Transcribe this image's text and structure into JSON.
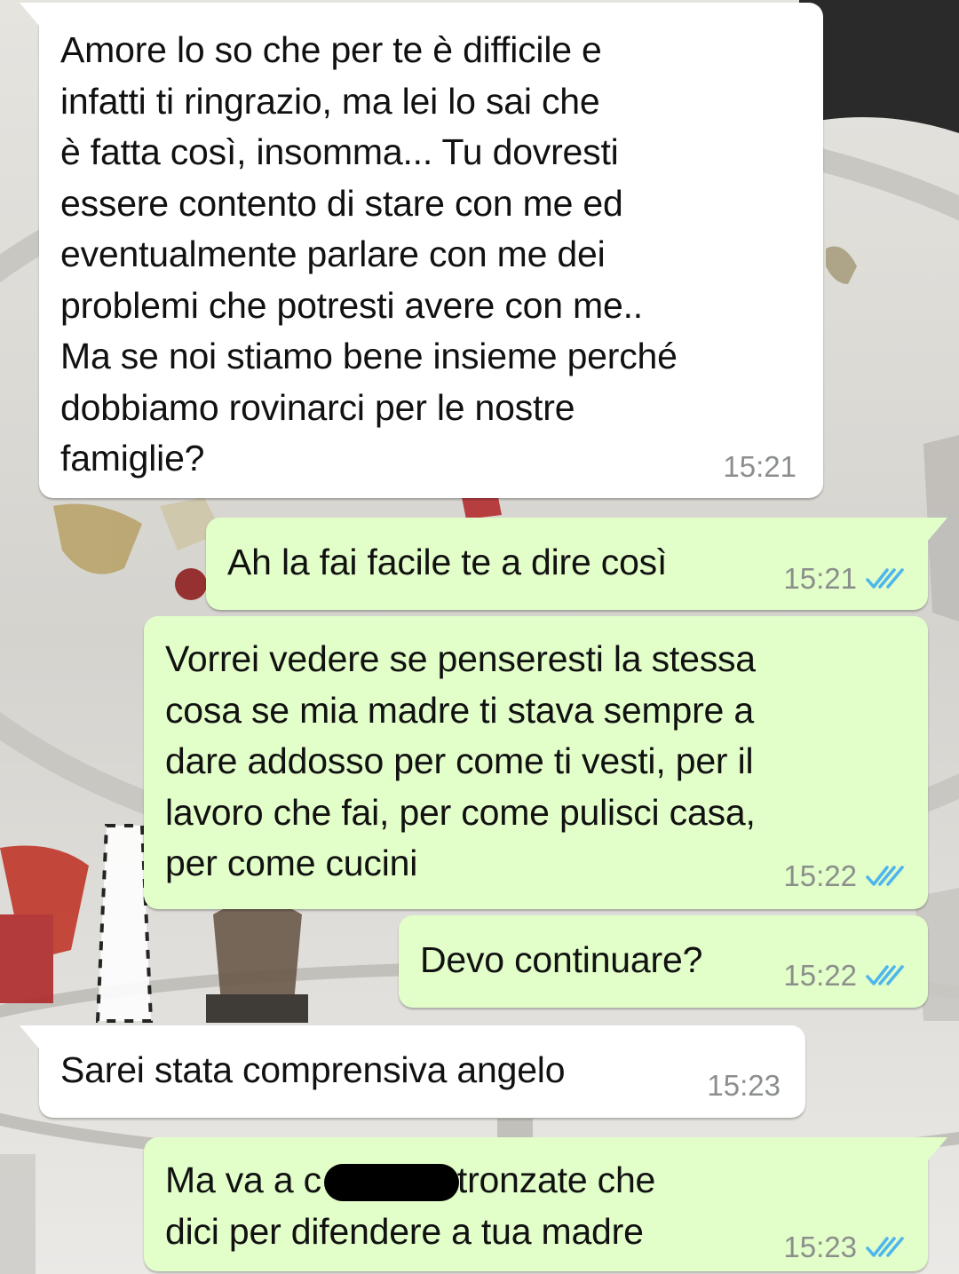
{
  "theme": {
    "incoming_bubble": "#ffffff",
    "outgoing_bubble": "#e2fec9",
    "read_ticks": "#4fb6ec",
    "timestamp": "#8b8f8c"
  },
  "messages": [
    {
      "direction": "incoming",
      "lines": [
        "Amore lo so che per te è difficile e",
        "infatti ti ringrazio, ma lei lo sai che",
        "è fatta così, insomma... Tu dovresti",
        "essere contento di stare con me ed",
        "eventualmente parlare con me dei",
        "problemi che potresti avere con me..",
        "Ma se noi stiamo bene insieme perché",
        "dobbiamo rovinarci per le nostre",
        "famiglie?"
      ],
      "time": "15:21"
    },
    {
      "direction": "outgoing",
      "lines": [
        "Ah la fai facile te a dire così"
      ],
      "time": "15:21",
      "status": "read-double-check-icon"
    },
    {
      "direction": "outgoing",
      "lines": [
        "Vorrei vedere se penseresti la stessa",
        "cosa se mia madre ti stava sempre a",
        "dare addosso per come ti vesti, per il",
        "lavoro che fai, per come pulisci casa,",
        "per come cucini"
      ],
      "time": "15:22",
      "status": "read-double-check-icon"
    },
    {
      "direction": "outgoing",
      "lines": [
        "Devo continuare?"
      ],
      "time": "15:22",
      "status": "read-double-check-icon"
    },
    {
      "direction": "incoming",
      "lines": [
        "Sarei stata comprensiva angelo"
      ],
      "time": "15:23"
    },
    {
      "direction": "outgoing",
      "lines": [
        "Ma va a c         te e le stronzate che",
        "dici per difendere a tua madre"
      ],
      "time": "15:23",
      "status": "read-double-check-icon"
    }
  ]
}
